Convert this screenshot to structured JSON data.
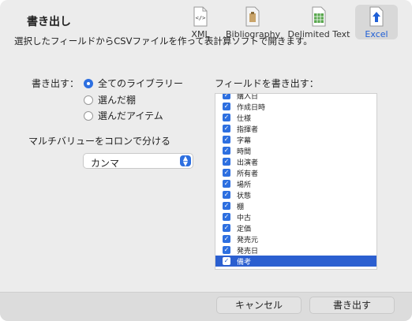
{
  "window": {
    "title": "書き出し"
  },
  "toolbar": {
    "items": [
      {
        "label": "XML",
        "icon": "xml-file-icon"
      },
      {
        "label": "Bibliography",
        "icon": "bibliography-file-icon"
      },
      {
        "label": "Delimited Text",
        "icon": "spreadsheet-file-icon"
      },
      {
        "label": "Excel",
        "icon": "excel-export-icon",
        "selected": true
      }
    ]
  },
  "content": {
    "description": "選択したフィールドからCSVファイルを作って表計算ソフトで開きます。",
    "export_label": "書き出す：",
    "export_options": [
      {
        "label": "全てのライブラリー",
        "selected": true
      },
      {
        "label": "選んだ棚",
        "selected": false
      },
      {
        "label": "選んだアイテム",
        "selected": false
      }
    ],
    "multivalue_label": "マルチバリューをコロンで分ける",
    "separator_select": {
      "value": "カンマ"
    },
    "fields_label": "フィールドを書き出す：",
    "fields": [
      {
        "label": "購入日",
        "checked": true
      },
      {
        "label": "作成日時",
        "checked": true
      },
      {
        "label": "仕様",
        "checked": true
      },
      {
        "label": "指揮者",
        "checked": true
      },
      {
        "label": "字幕",
        "checked": true
      },
      {
        "label": "時間",
        "checked": true
      },
      {
        "label": "出演者",
        "checked": true
      },
      {
        "label": "所有者",
        "checked": true
      },
      {
        "label": "場所",
        "checked": true
      },
      {
        "label": "状態",
        "checked": true
      },
      {
        "label": "棚",
        "checked": true
      },
      {
        "label": "中古",
        "checked": true
      },
      {
        "label": "定価",
        "checked": true
      },
      {
        "label": "発売元",
        "checked": true
      },
      {
        "label": "発売日",
        "checked": true
      },
      {
        "label": "備考",
        "checked": true,
        "highlighted": true
      }
    ]
  },
  "buttons": {
    "cancel": "キャンセル",
    "export": "書き出す"
  },
  "colors": {
    "accent": "#2d6fe0",
    "selection": "#2b5fd0"
  }
}
